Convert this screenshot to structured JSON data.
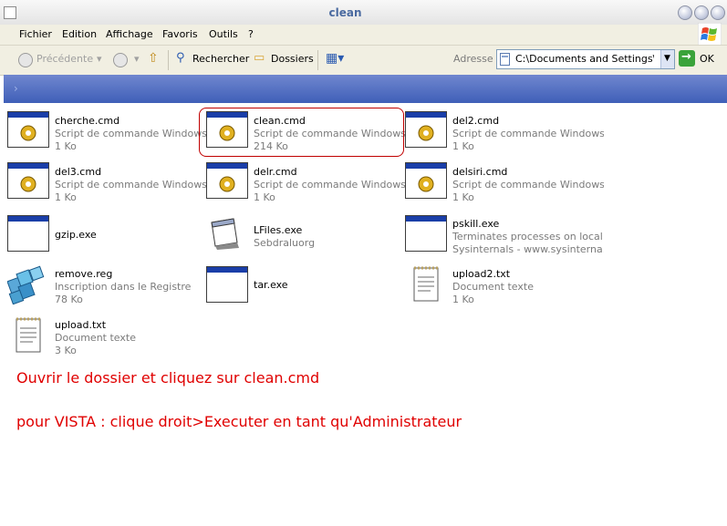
{
  "window": {
    "title": "clean"
  },
  "menu": [
    "Fichier",
    "Edition",
    "Affichage",
    "Favoris",
    "Outils",
    "?"
  ],
  "toolbar": {
    "back_label": "Précédente",
    "search_label": "Rechercher",
    "folders_label": "Dossiers",
    "address_label": "Adresse",
    "address_value": "C:\\Documents and Settings\\Bern",
    "go_label": "OK"
  },
  "files": [
    {
      "name": "cherche.cmd",
      "desc": "Script de commande Windows NT",
      "size": "1 Ko",
      "icon": "cmd-script-icon"
    },
    {
      "name": "clean.cmd",
      "desc": "Script de commande Windows NT",
      "size": "214 Ko",
      "icon": "cmd-script-icon"
    },
    {
      "name": "del2.cmd",
      "desc": "Script de commande Windows NT",
      "size": "1 Ko",
      "icon": "cmd-script-icon"
    },
    {
      "name": "del3.cmd",
      "desc": "Script de commande Windows NT",
      "size": "1 Ko",
      "icon": "cmd-script-icon"
    },
    {
      "name": "delr.cmd",
      "desc": "Script de commande Windows NT",
      "size": "1 Ko",
      "icon": "cmd-script-icon"
    },
    {
      "name": "delsiri.cmd",
      "desc": "Script de commande Windows NT",
      "size": "1 Ko",
      "icon": "cmd-script-icon"
    },
    {
      "name": "gzip.exe",
      "desc": "",
      "size": "",
      "icon": "exe-window-icon"
    },
    {
      "name": "LFiles.exe",
      "desc": "Sebdraluorg",
      "size": "",
      "icon": "lfiles-app-icon"
    },
    {
      "name": "pskill.exe",
      "desc": "Terminates processes on local ...",
      "size": "Sysinternals - www.sysinterna...",
      "icon": "exe-window-icon"
    },
    {
      "name": "remove.reg",
      "desc": "Inscription dans le Registre",
      "size": "78 Ko",
      "icon": "registry-file-icon"
    },
    {
      "name": "tar.exe",
      "desc": "",
      "size": "",
      "icon": "exe-window-icon"
    },
    {
      "name": "upload2.txt",
      "desc": "Document texte",
      "size": "1 Ko",
      "icon": "text-document-icon"
    },
    {
      "name": "upload.txt",
      "desc": "Document texte",
      "size": "3 Ko",
      "icon": "text-document-icon"
    }
  ],
  "notes": {
    "line1": "Ouvrir le dossier et cliquez sur clean.cmd",
    "line2": "pour VISTA : clique droit>Executer en tant qu'Administrateur"
  },
  "colors": {
    "note_text": "#e00000",
    "highlight_border": "#c00000",
    "header_bar": "#4a68c0"
  }
}
